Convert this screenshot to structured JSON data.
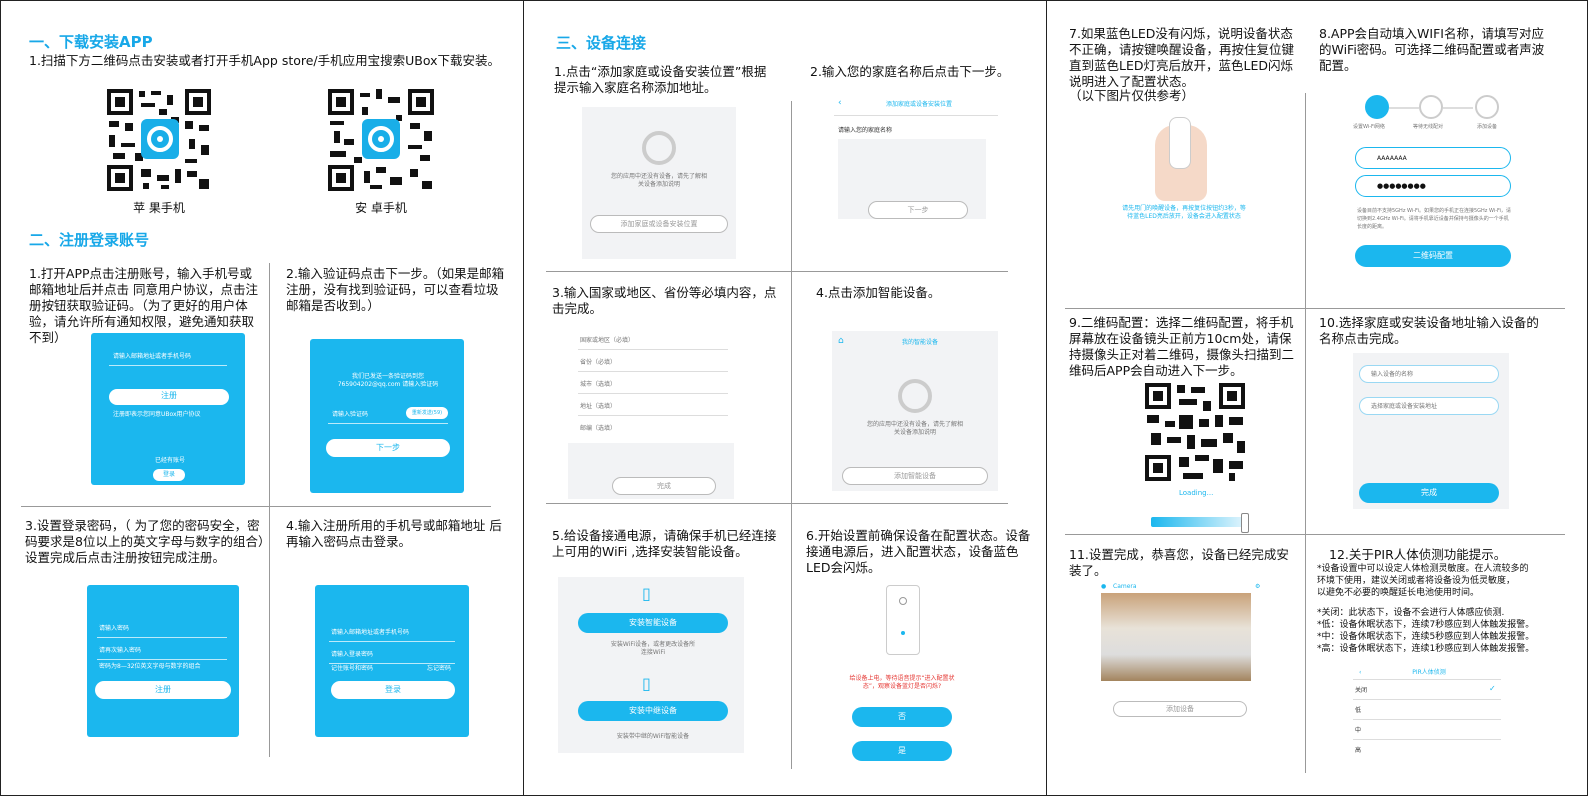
{
  "panel1": {
    "s1_title": "一、下载安装APP",
    "s1_text": "1.扫描下方二维码点击安装或者打开手机App store/手机应用宝搜索UBox下载安装。",
    "qr_ios_caption": "苹 果手机",
    "qr_android_caption": "安 卓手机",
    "s2_title": "二、注册登录账号",
    "step1": "1.打开APP点击注册账号，输入手机号或邮箱地址后并点击 同意用户协议，点击注册按钮获取验证码。（为了更好的用户体验，请允许所有通知权限，避免通知获取不到）",
    "step2": "2.输入验证码点击下一步。（如果是邮箱注册，没有找到验证码，可以查看垃圾邮箱是否收到。）",
    "step3": "3.设置登录密码，（ 为了您的密码安全，密码要求是8位以上的英文字母与数字的组合）设置完成后点击注册按钮完成注册。",
    "step4": "4.输入注册所用的手机号或邮箱地址 后再输入密码点击登录。",
    "ss1": {
      "placeholder": "请输入邮箱地址或者手机号码",
      "btn": "注册",
      "agree": "注册即表示您同意UBox用户协议",
      "has_account": "已经有账号",
      "login": "登录"
    },
    "ss2": {
      "hint": "我们已发送一条验证码到您765904202@qq.com 请输入验证码",
      "placeholder": "请输入验证码",
      "resend": "重新发送(59)",
      "btn": "下一步"
    },
    "ss3": {
      "p1": "请输入密码",
      "p2": "请再次输入密码",
      "rule": "密码为8—32位英文字母与数字的组合",
      "btn": "注册"
    },
    "ss4": {
      "p1": "请输入邮箱地址或者手机号码",
      "p2": "请输入登录密码",
      "remember": "记住账号和密码",
      "forgot": "忘记密码",
      "btn": "登录"
    }
  },
  "panel2": {
    "s3_title": "三、设备连接",
    "step1": "1.点击“添加家庭或设备安装位置”根据提示输入家庭名称添加地址。",
    "step2": "2.输入您的家庭名称后点击下一步。",
    "step3": "3.输入国家或地区、省份等必填内容，点击完成。",
    "step4": "4.点击添加智能设备。",
    "step5": "5.给设备接通电源，请确保手机已经连接上可用的WiFi ,选择安装智能设备。",
    "step6": "6.开始设置前确保设备在配置状态。设备接通电源后，进入配置状态，设备蓝色LED会闪烁。",
    "ss1": {
      "empty": "您的应用中还没有设备，请先了解相关设备添加说明",
      "btn": "添加家庭或设备安装位置"
    },
    "ss2": {
      "title": "添加家庭或设备安装位置",
      "label": "请输入您的家庭名称",
      "btn": "下一步"
    },
    "ss3": {
      "fields": [
        "国家或地区（必填）",
        "省份（必填）",
        "城市（选填）",
        "地址（选填）",
        "邮编（选填）"
      ],
      "btn": "完成"
    },
    "ss4": {
      "title": "我的智能设备",
      "empty": "您的应用中还没有设备，请先了解相关设备添加说明",
      "btn": "添加智能设备"
    },
    "ss5": {
      "btn1": "安装智能设备",
      "desc1": "安装WiFi设备，或者更改设备所连接WiFi",
      "btn2": "安装中继设备",
      "desc2": "安装带中继的WiFi智能设备"
    },
    "ss6": {
      "note": "给设备上电，等待语音提示“进入配置状态”，观察设备蓝灯是否闪烁?",
      "no": "否",
      "yes": "是"
    }
  },
  "panel3": {
    "step7": "7.如果蓝色LED没有闪烁，说明设备状态不正确，请按键唤醒设备，再按住复位键直到蓝色LED灯亮后放开，蓝色LED闪烁说明进入了配置状态。",
    "step7_note": "（以下图片仅供参考）",
    "step8": "8.APP会自动填入WIFI名称，请填写对应的WiFi密码。可选择二维码配置或者声波配置。",
    "step9": "9.二维码配置：选择二维码配置，将手机屏幕放在设备镜头正前方10cm处，请保持摄像头正对着二维码，摄像头扫描到二维码后APP会自动进入下一步。",
    "step10": "10.选择家庭或安装设备地址输入设备的名称点击完成。",
    "step11": "11.设置完成，恭喜您，设备已经完成安装了。",
    "step12_title": "12.关于PIR人体侦测功能提示。",
    "step12_lines": [
      "*设备设置中可以设定人体检测灵敏度。在人流较多的",
      "环境下使用，建议关闭或者将设备设为低灵敏度，",
      "以避免不必要的唤醒延长电池使用时间。",
      "",
      "*关闭：此状态下，设备不会进行人体感应侦测.",
      "*低：设备休眠状态下，连续7秒感应到人体触发报警。",
      "*中：设备休眠状态下，连续5秒感应到人体触发报警。",
      "*高：设备休眠状态下，连续1秒感应到人体触发报警。"
    ],
    "ss7": {
      "text": "请先用门的唤醒设备，再按复位按钮约3秒，等待蓝色LED亮后放开，设备会进入配置状态"
    },
    "ss8": {
      "steps": [
        "设置Wi-Fi网络",
        "等待无线配对",
        "添加设备"
      ],
      "ssid": "AAAAAAA",
      "pwd": "●●●●●●●●",
      "tip": "设备目前不支持5GHz Wi-Fi。如果您的手机正在连接5GHz Wi-Fi，请切换到2.4GHz Wi-Fi。请将手机靠近设备并保持与摄像头的一个手机长度的距离。",
      "btn": "二维码配置"
    },
    "ss9": {
      "loading": "Loading..."
    },
    "ss10": {
      "name": "输入设备的名称",
      "addr": "选择家庭或设备安装地址",
      "btn": "完成"
    },
    "ss11": {
      "title": "Camera",
      "btn": "添加设备"
    },
    "ss12": {
      "title": "PIR人体侦测",
      "options": [
        "关闭",
        "低",
        "中",
        "高"
      ]
    }
  }
}
